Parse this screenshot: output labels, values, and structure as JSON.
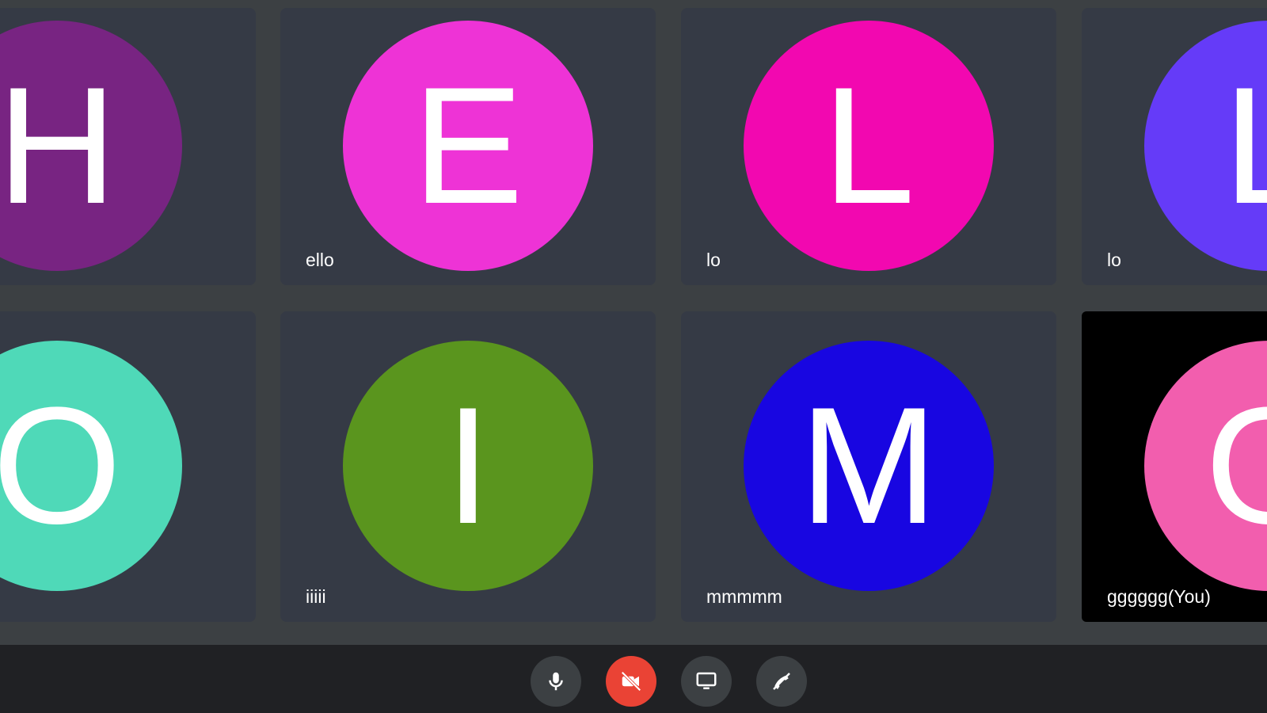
{
  "participants": [
    {
      "initial": "H",
      "name": "",
      "color": "#782482"
    },
    {
      "initial": "E",
      "name": "ello",
      "color": "#ee33d6"
    },
    {
      "initial": "L",
      "name": "lo",
      "color": "#f208b0"
    },
    {
      "initial": "L",
      "name": "lo",
      "color": "#653bf8"
    },
    {
      "initial": "O",
      "name": "",
      "color": "#4fd9b8"
    },
    {
      "initial": "I",
      "name": "iiiii",
      "color": "#5a951e"
    },
    {
      "initial": "M",
      "name": "mmmmm",
      "color": "#1806e1"
    },
    {
      "initial": "G",
      "name": "gggggg(You)",
      "color": "#f25eae"
    }
  ],
  "toolbar": {
    "microphone": {
      "icon": "microphone-icon",
      "state": "on"
    },
    "camera": {
      "icon": "camera-off-icon",
      "state": "off",
      "color": "#ea4335"
    },
    "present": {
      "icon": "present-screen-icon"
    },
    "leave": {
      "icon": "hang-up-icon"
    }
  }
}
